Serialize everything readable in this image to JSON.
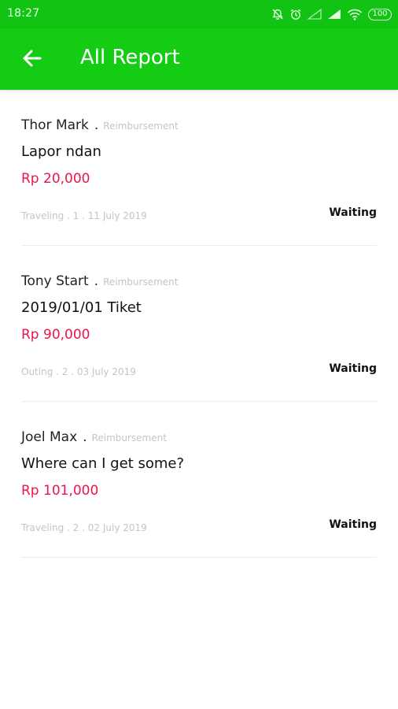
{
  "status_bar": {
    "time": "18:27",
    "battery": "100"
  },
  "header": {
    "title": "All Report"
  },
  "colors": {
    "status_bar": "#13c313",
    "app_bar": "#14cc14",
    "amount": "#e8164a",
    "muted": "#c4c4c4"
  },
  "reports": [
    {
      "name": "Thor Mark",
      "separator": ".",
      "type": "Reimbursement",
      "title": "Lapor ndan",
      "amount": "Rp 20,000",
      "meta": "Traveling . 1 . 11 July 2019",
      "status": "Waiting"
    },
    {
      "name": "Tony Start",
      "separator": ".",
      "type": "Reimbursement",
      "title": "2019/01/01 Tiket",
      "amount": "Rp 90,000",
      "meta": "Outing . 2 . 03 July 2019",
      "status": "Waiting"
    },
    {
      "name": "Joel Max",
      "separator": ".",
      "type": "Reimbursement",
      "title": "Where can I get some?",
      "amount": "Rp 101,000",
      "meta": "Traveling . 2 . 02 July 2019",
      "status": "Waiting"
    }
  ]
}
